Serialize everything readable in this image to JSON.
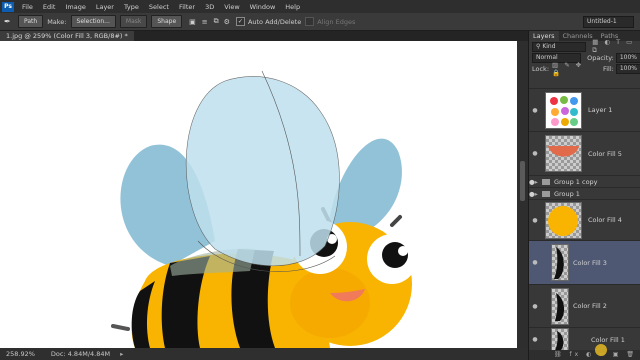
{
  "menu": {
    "app_badge": "Ps",
    "items": [
      "File",
      "Edit",
      "Image",
      "Layer",
      "Type",
      "Select",
      "Filter",
      "3D",
      "View",
      "Window",
      "Help"
    ]
  },
  "options": {
    "path_mode": "Path",
    "make_label": "Make:",
    "selection_btn": "Selection...",
    "mask_btn": "Mask",
    "shape_btn": "Shape",
    "auto_add_delete": "Auto Add/Delete",
    "align_edges": "Align Edges",
    "workspace": "Untitled-1"
  },
  "document": {
    "tab_title": "1.jpg @ 259% (Color Fill 3, RGB/8#) *",
    "zoom": "258.92%",
    "doc_size": "Doc: 4.84M/4.84M"
  },
  "panel": {
    "tabs": [
      "Layers",
      "Channels",
      "Paths"
    ],
    "kind": "Kind",
    "blend_mode": "Normal",
    "opacity_label": "Opacity:",
    "opacity_value": "100%",
    "lock_label": "Lock:",
    "fill_label": "Fill:",
    "fill_value": "100%"
  },
  "layers": [
    {
      "name": "Layer 1"
    },
    {
      "name": "Color Fill 5"
    },
    {
      "name": "Group 1 copy"
    },
    {
      "name": "Group 1"
    },
    {
      "name": "Color Fill 4"
    },
    {
      "name": "Color Fill 3"
    },
    {
      "name": "Color Fill 2"
    },
    {
      "name": "Color Fill 1"
    }
  ],
  "colors": {
    "bee_yellow": "#f8b400",
    "wing_blue": "#7fb7d0",
    "wing_light": "#bfe0ee",
    "stripe": "#111111",
    "selected_layer": "#4e5873"
  }
}
